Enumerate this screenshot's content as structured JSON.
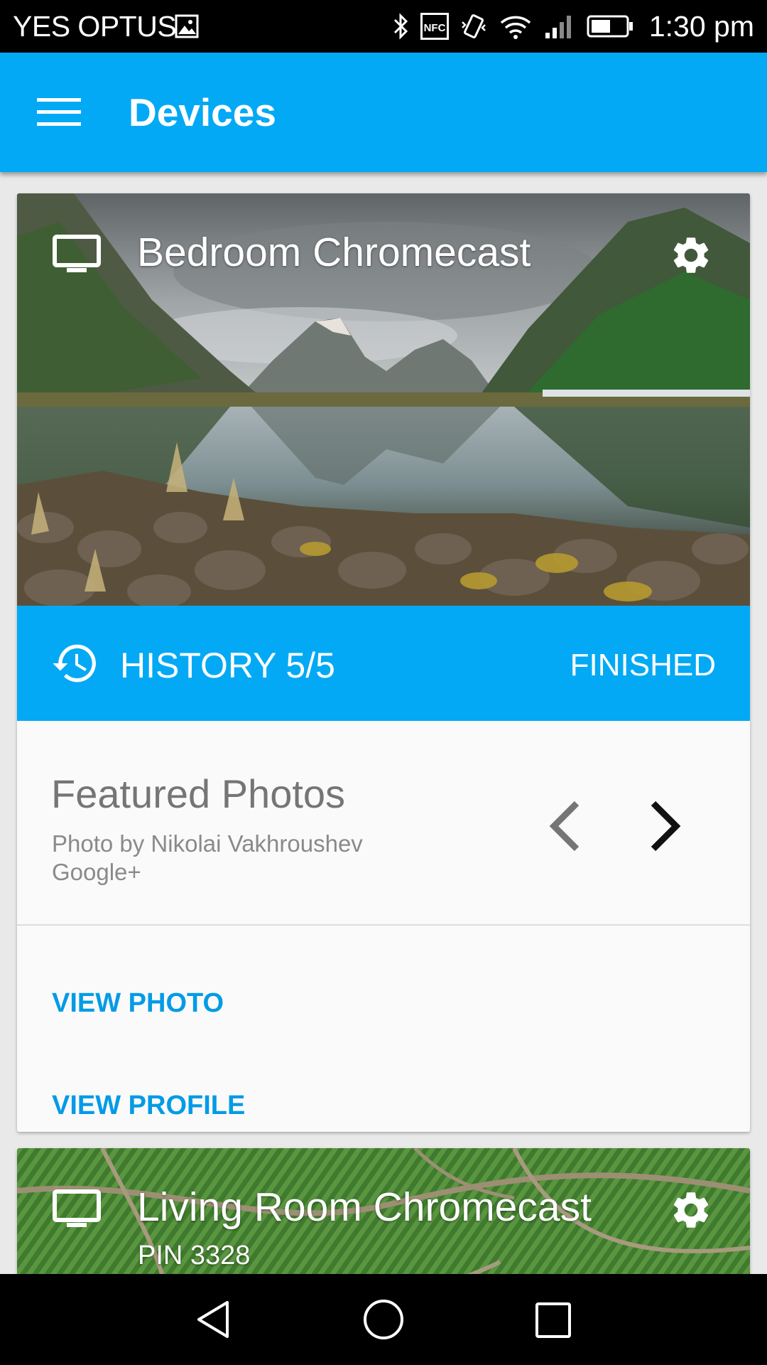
{
  "status_bar": {
    "carrier": "YES OPTUS",
    "time": "1:30 pm",
    "icons": [
      "gallery-icon",
      "bluetooth-icon",
      "nfc-icon",
      "vibrate-icon",
      "wifi-icon",
      "signal-icon",
      "battery-icon"
    ],
    "nfc_text": "NFC"
  },
  "app_bar": {
    "title": "Devices",
    "menu_icon": "hamburger-menu-icon"
  },
  "devices": [
    {
      "name": "Bedroom Chromecast",
      "icon": "tv-icon",
      "settings_icon": "gear-icon",
      "history_label": "HISTORY 5/5",
      "status": "FINISHED",
      "photo_title": "Featured Photos",
      "photo_credit_line1": "Photo by Nikolai Vakhroushev",
      "photo_credit_line2": "Google+",
      "actions": {
        "view_photo": "VIEW PHOTO",
        "view_profile": "VIEW PROFILE"
      }
    },
    {
      "name": "Living Room Chromecast",
      "pin": "PIN 3328",
      "icon": "tv-icon",
      "settings_icon": "gear-icon"
    }
  ],
  "colors": {
    "primary": "#03a9f4",
    "link": "#039be5",
    "card_bg": "#fafafa",
    "page_bg": "#e9e9e9"
  },
  "nav_bar": {
    "icons": [
      "back-icon",
      "home-icon",
      "recents-icon"
    ]
  }
}
